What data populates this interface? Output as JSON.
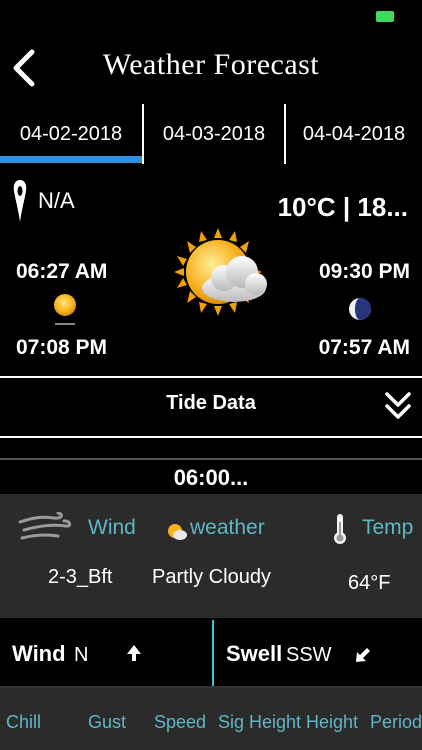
{
  "header": {
    "title": "Weather Forecast"
  },
  "tabs": [
    {
      "label": "04-02-2018",
      "selected": true
    },
    {
      "label": "04-03-2018",
      "selected": false
    },
    {
      "label": "04-04-2018",
      "selected": false
    }
  ],
  "summary": {
    "location": "N/A",
    "temperature": "10°C | 18...",
    "sunrise": "06:27 AM",
    "sunset": "07:08 PM",
    "moonrise": "09:30 PM",
    "moonset": "07:57 AM",
    "icons": {
      "location": "location-pin-icon",
      "main": "partly-cloudy-icon",
      "sun": "sun-icon",
      "moon": "moon-icon"
    }
  },
  "tide": {
    "label": "Tide Data"
  },
  "forecast": {
    "time": "06:00...",
    "wind_label": "Wind",
    "weather_label": "weather",
    "temp_label": "Temp",
    "wind_value": "2-3_Bft",
    "weather_value": "Partly Cloudy",
    "temp_value": "64°F"
  },
  "details": {
    "wind": {
      "title": "Wind",
      "direction": "N"
    },
    "swell": {
      "title": "Swell",
      "direction": "SSW"
    },
    "columns": [
      "Chill",
      "Gust",
      "Speed",
      "Sig Height",
      "Height",
      "Period"
    ]
  },
  "colors": {
    "accent": "#2f8fe0",
    "label": "#5fb6c6",
    "divider": "#3fc7d6",
    "panel": "#2b2b2b",
    "battery": "#3ddc5a"
  }
}
